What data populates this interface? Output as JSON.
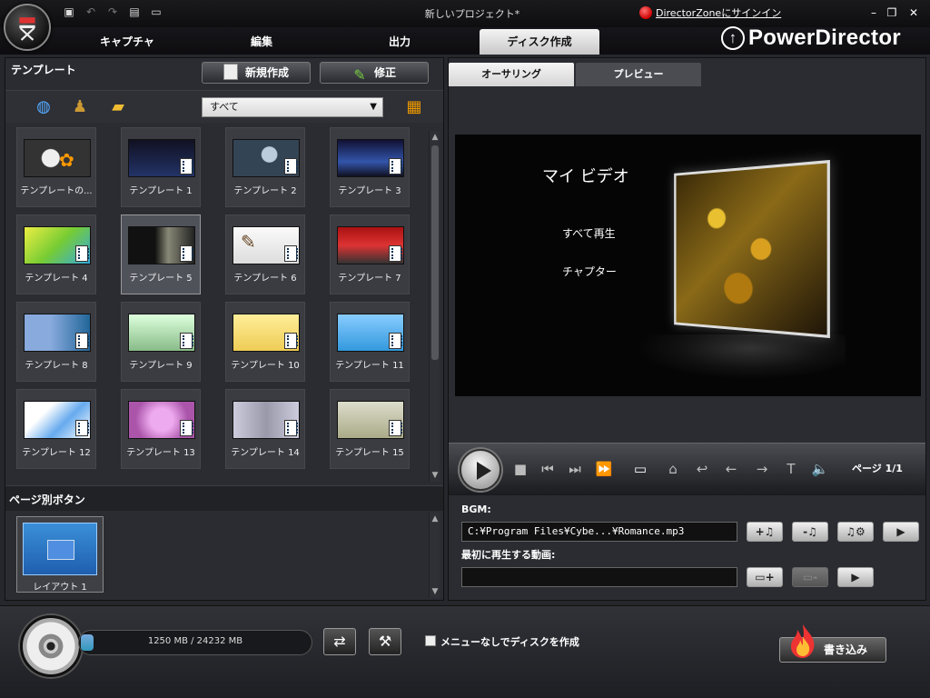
{
  "titlebar": {
    "project_title": "新しいプロジェクト*",
    "signin_link": "DirectorZoneにサインイン",
    "min_icon": "minimize-icon",
    "restore_icon": "restore-icon",
    "close_icon": "close-icon"
  },
  "main_tabs": [
    {
      "label": "キャプチャ",
      "active": false
    },
    {
      "label": "編集",
      "active": false
    },
    {
      "label": "出力",
      "active": false
    },
    {
      "label": "ディスク作成",
      "active": true
    }
  ],
  "brand": "PowerDirector",
  "template_panel": {
    "title": "テンプレート",
    "new_button": "新規作成",
    "edit_button": "修正",
    "filter_value": "すべて",
    "templates": [
      {
        "label": "テンプレートの...",
        "selected": false
      },
      {
        "label": "テンプレート 1",
        "selected": false
      },
      {
        "label": "テンプレート 2",
        "selected": false
      },
      {
        "label": "テンプレート 3",
        "selected": false
      },
      {
        "label": "テンプレート 4",
        "selected": false
      },
      {
        "label": "テンプレート 5",
        "selected": true
      },
      {
        "label": "テンプレート 6",
        "selected": false
      },
      {
        "label": "テンプレート 7",
        "selected": false
      },
      {
        "label": "テンプレート 8",
        "selected": false
      },
      {
        "label": "テンプレート 9",
        "selected": false
      },
      {
        "label": "テンプレート 10",
        "selected": false
      },
      {
        "label": "テンプレート 11",
        "selected": false
      },
      {
        "label": "テンプレート 12",
        "selected": false
      },
      {
        "label": "テンプレート 13",
        "selected": false
      },
      {
        "label": "テンプレート 14",
        "selected": false
      },
      {
        "label": "テンプレート 15",
        "selected": false
      }
    ],
    "page_buttons_title": "ページ別ボタン",
    "layout_label": "レイアウト 1"
  },
  "authoring_panel": {
    "tab_authoring": "オーサリング",
    "tab_preview": "プレビュー",
    "menu_title": "マイ ビデオ",
    "menu_play_all": "すべて再生",
    "menu_chapters": "チャプター",
    "page_indicator": "ページ 1/1",
    "bgm_label": "BGM:",
    "bgm_path": "C:¥Program Files¥Cybe...¥Romance.mp3",
    "first_play_label": "最初に再生する動画:",
    "first_play_value": ""
  },
  "bottom": {
    "capacity_text": "1250 MB / 24232 MB",
    "capacity_used_mb": 1250,
    "capacity_total_mb": 24232,
    "no_menu_checkbox_label": "メニューなしでディスクを作成",
    "no_menu_checked": false,
    "burn_button": "書き込み"
  },
  "colors": {
    "background": "#25272c",
    "active_tab": "#e8e8e8",
    "accent_blue": "#3a8fd8"
  }
}
